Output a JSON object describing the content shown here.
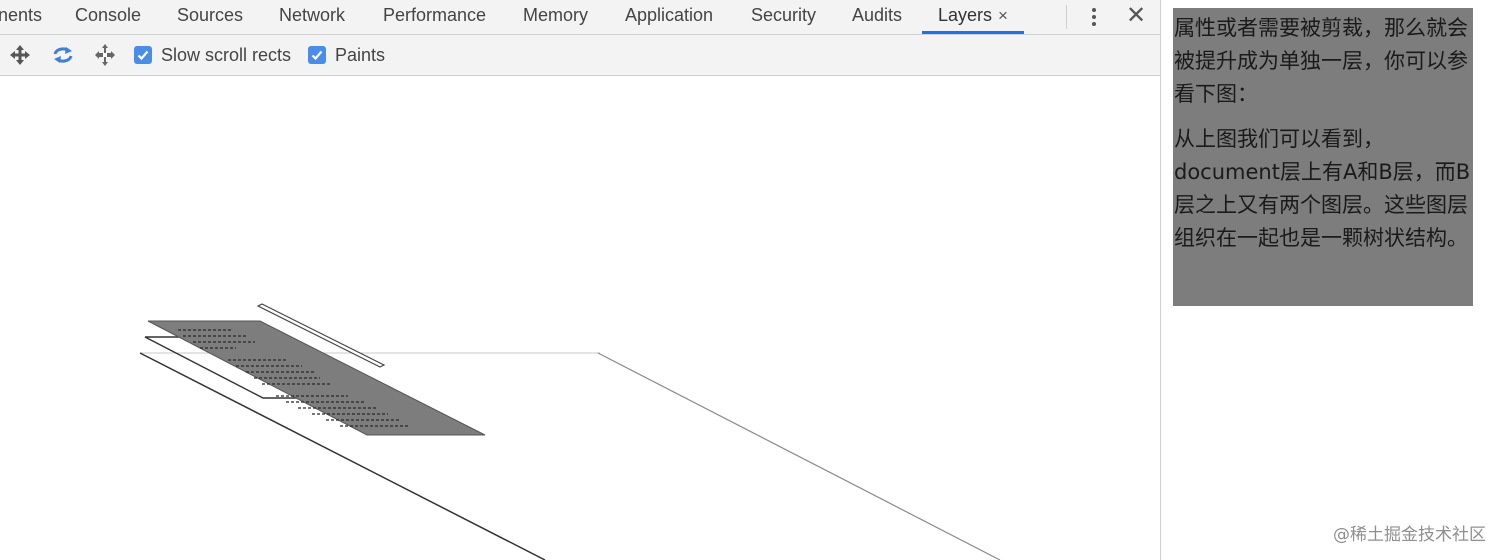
{
  "tabs": [
    {
      "label": "nents",
      "active": false
    },
    {
      "label": "Console",
      "active": false
    },
    {
      "label": "Sources",
      "active": false
    },
    {
      "label": "Network",
      "active": false
    },
    {
      "label": "Performance",
      "active": false
    },
    {
      "label": "Memory",
      "active": false
    },
    {
      "label": "Application",
      "active": false
    },
    {
      "label": "Security",
      "active": false
    },
    {
      "label": "Audits",
      "active": false
    },
    {
      "label": "Layers",
      "active": true,
      "closable": true
    }
  ],
  "tab_close_glyph": "×",
  "panel_close_glyph": "✕",
  "toolbar": {
    "icons": [
      "pan-icon",
      "rotate-icon",
      "move-icon"
    ],
    "checkboxes": [
      {
        "label": "Slow scroll rects",
        "checked": true
      },
      {
        "label": "Paints",
        "checked": true
      }
    ]
  },
  "side_panel": {
    "paragraph_1": "属性或者需要被剪裁，那么就会被提升成为单独一层，你可以参看下图：",
    "paragraph_2": "从上图我们可以看到，document层上有A和B层，而B层之上又有两个图层。这些图层组织在一起也是一颗树状结构。",
    "watermark": "@稀土掘金技术社区"
  },
  "colors": {
    "accent": "#1a73e8",
    "checkbox": "#4a8de8",
    "toolbar_bg": "#f3f3f3",
    "layer_fill": "#7d7d7d"
  }
}
